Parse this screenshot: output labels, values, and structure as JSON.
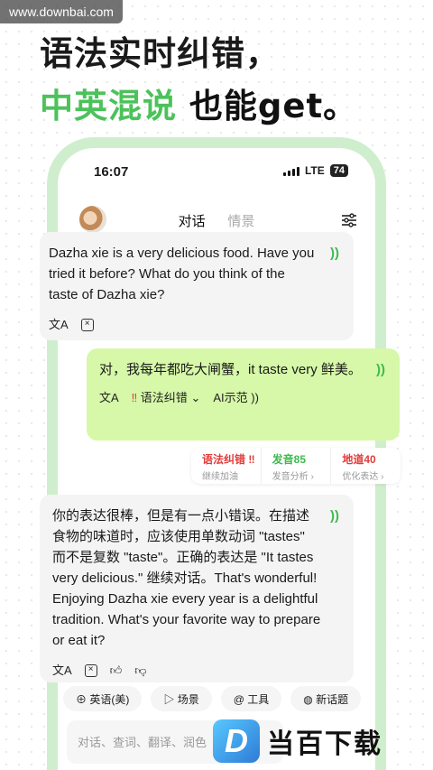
{
  "watermark_top": "www.downbai.com",
  "headline": {
    "line1": "语法实时纠错，",
    "line2_green": "中英混说",
    "line2_dark": "也能get。"
  },
  "status_bar": {
    "time": "16:07",
    "network": "LTE",
    "battery": "74"
  },
  "chat_header": {
    "tab_active": "对话",
    "tab_inactive": "情景"
  },
  "messages": [
    {
      "text": "Dazha xie is a very delicious food. Have you tried it before? What do you think of the taste of Dazha xie?"
    },
    {
      "text": "对，我每年都吃大闸蟹，it taste very 鲜美。",
      "grammar_label": "语法纠错",
      "ai_label": "AI示范"
    },
    {
      "text": "你的表达很棒，但是有一点小错误。在描述食物的味道时，应该使用单数动词 \"tastes\" 而不是复数 \"taste\"。正确的表达是 \"It tastes very delicious.\" 继续对话。That's wonderful! Enjoying Dazha xie every year is a delightful tradition. What's your favorite way to prepare or eat it?"
    }
  ],
  "score_card": [
    {
      "title": "语法纠错 ‼",
      "sub": "继续加油"
    },
    {
      "title": "发音85",
      "sub": "发音分析 ›"
    },
    {
      "title": "地道40",
      "sub": "优化表达 ›"
    }
  ],
  "toolbar": [
    "英语(美)",
    "场景",
    "工具",
    "新话题"
  ],
  "input": {
    "placeholder": "对话、查词、翻译、润色"
  },
  "logo": {
    "text": "当百下载",
    "letter": "D"
  },
  "colors": {
    "accent_green": "#4cc25a",
    "bubble_green": "#d6f8a8",
    "error_red": "#e23b3b"
  }
}
